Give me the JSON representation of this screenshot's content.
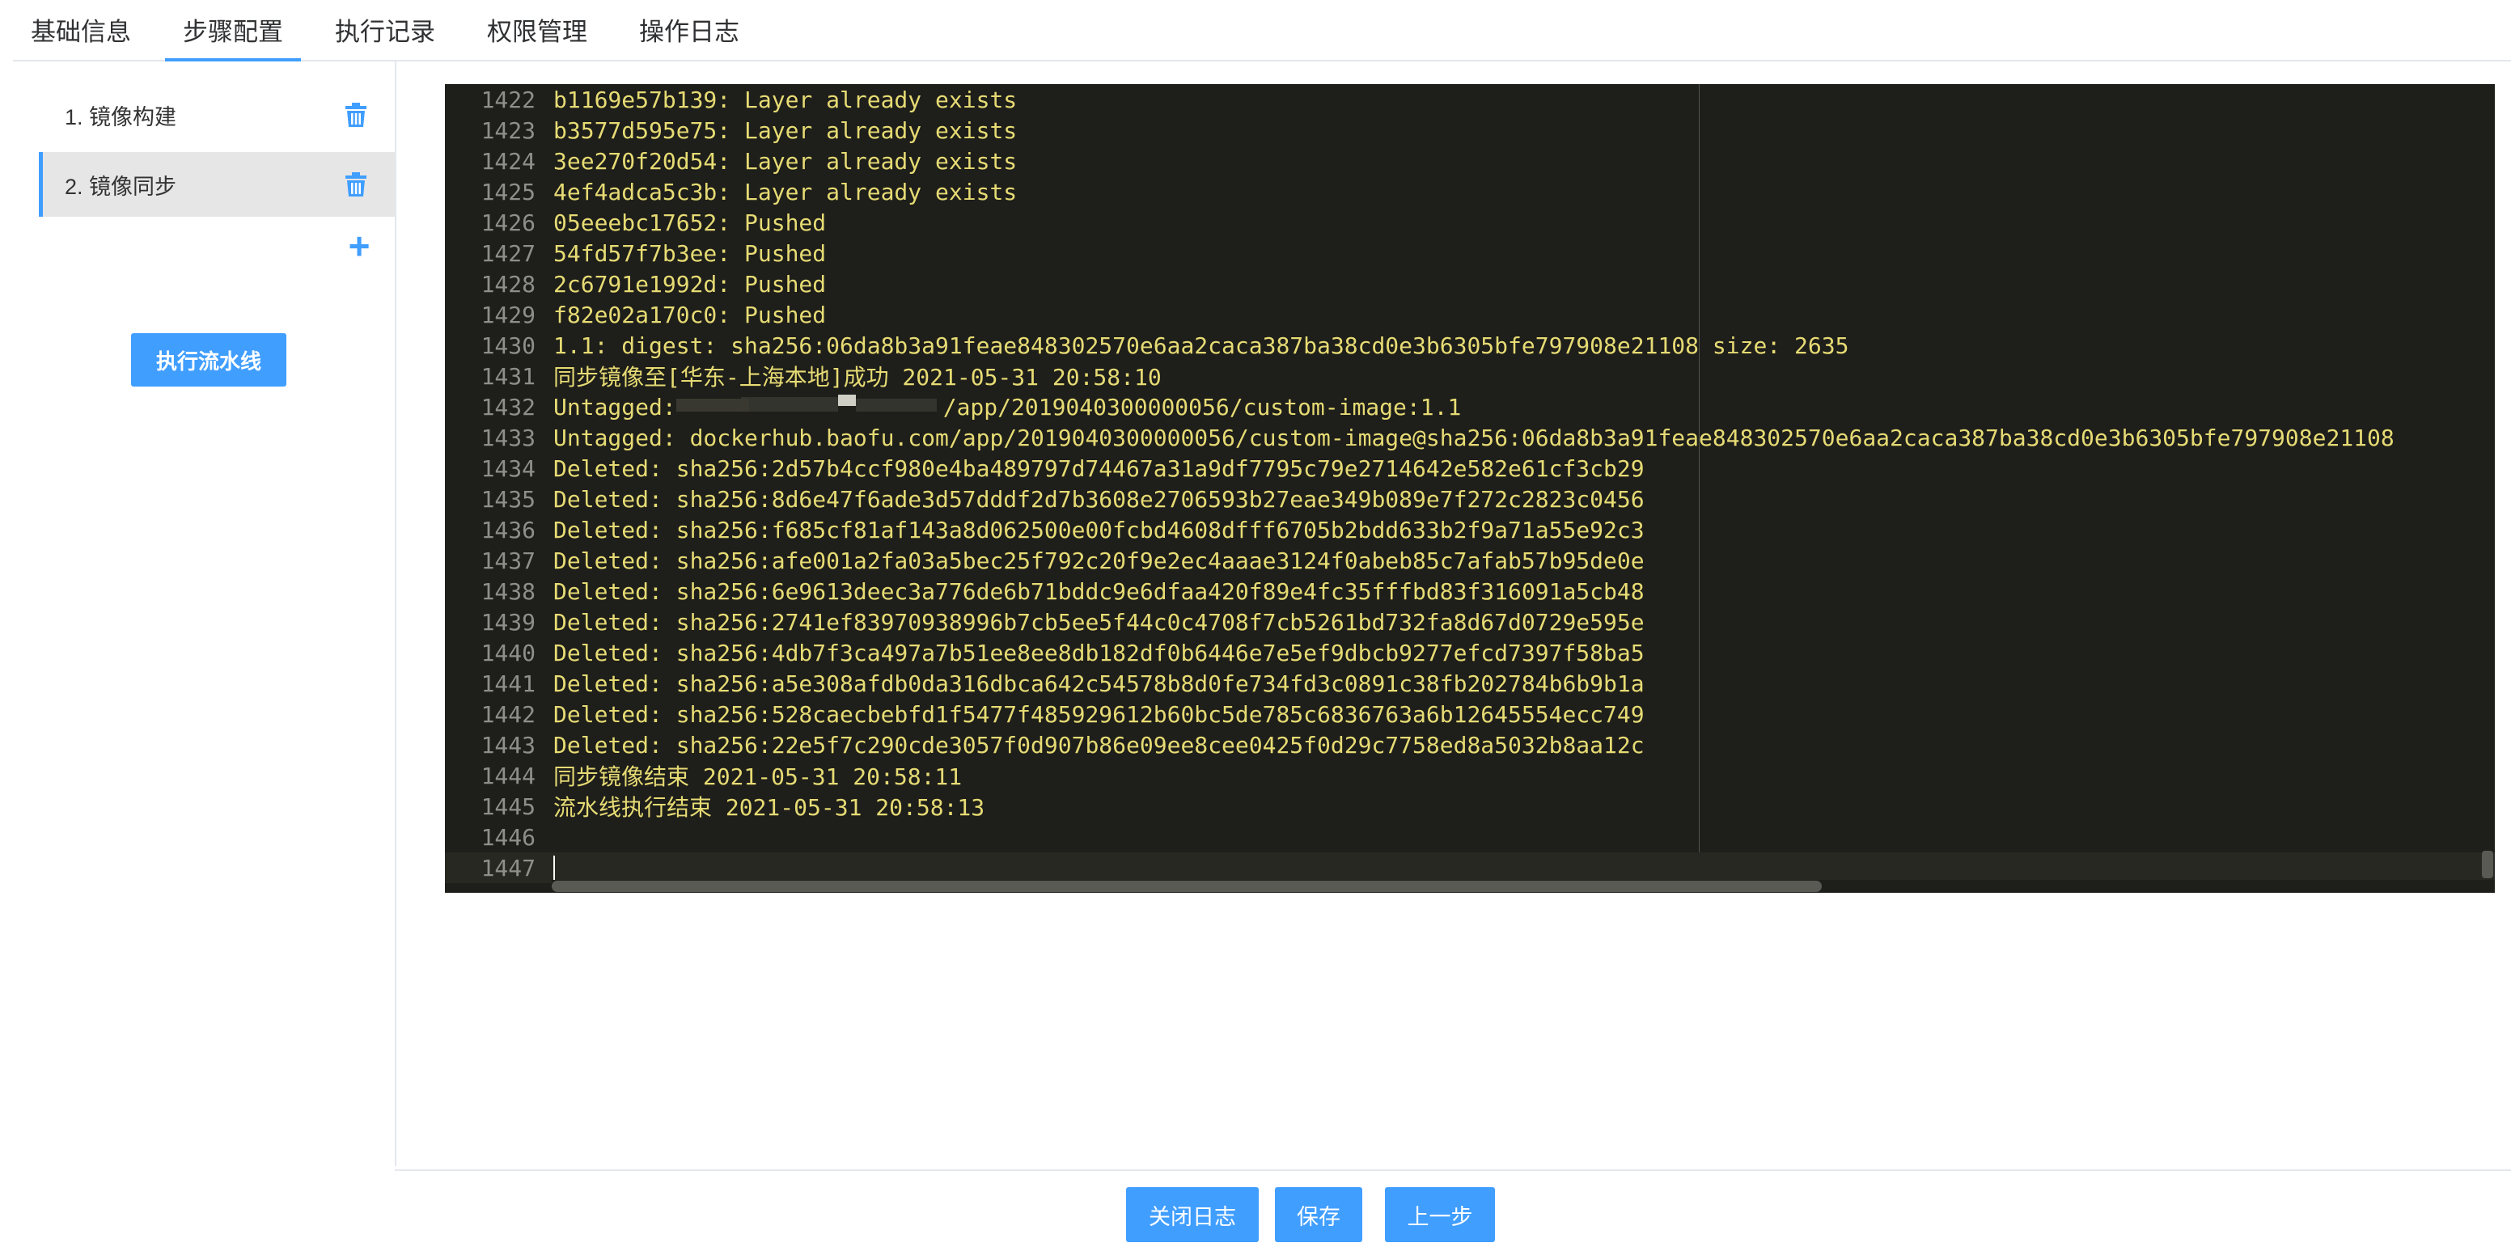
{
  "tabs": [
    "基础信息",
    "步骤配置",
    "执行记录",
    "权限管理",
    "操作日志"
  ],
  "active_tab": "步骤配置",
  "sidebar": {
    "steps": [
      {
        "label": "1. 镜像构建",
        "icon": "trash-icon"
      },
      {
        "label": "2. 镜像同步",
        "icon": "trash-icon"
      }
    ],
    "add_icon": "plus-icon",
    "run_button": "执行流水线"
  },
  "log": {
    "lines": [
      {
        "n": "1422",
        "t": "b1169e57b139: Layer already exists"
      },
      {
        "n": "1423",
        "t": "b3577d595e75: Layer already exists"
      },
      {
        "n": "1424",
        "t": "3ee270f20d54: Layer already exists"
      },
      {
        "n": "1425",
        "t": "4ef4adca5c3b: Layer already exists"
      },
      {
        "n": "1426",
        "t": "05eeebc17652: Pushed"
      },
      {
        "n": "1427",
        "t": "54fd57f7b3ee: Pushed"
      },
      {
        "n": "1428",
        "t": "2c6791e1992d: Pushed"
      },
      {
        "n": "1429",
        "t": "f82e02a170c0: Pushed"
      },
      {
        "n": "1430",
        "t": "1.1: digest: sha256:06da8b3a91feae848302570e6aa2caca387ba38cd0e3b6305bfe797908e21108 size: 2635"
      },
      {
        "n": "1431",
        "t": "同步镜像至[华东-上海本地]成功 2021-05-31 20:58:10"
      },
      {
        "n": "1432",
        "t": "Untagged: ",
        "t2": "/app/2019040300000056/custom-image:1.1"
      },
      {
        "n": "1433",
        "t": "Untagged: dockerhub.baofu.com/app/2019040300000056/custom-image@sha256:06da8b3a91feae848302570e6aa2caca387ba38cd0e3b6305bfe797908e21108"
      },
      {
        "n": "1434",
        "t": "Deleted: sha256:2d57b4ccf980e4ba489797d74467a31a9df7795c79e2714642e582e61cf3cb29"
      },
      {
        "n": "1435",
        "t": "Deleted: sha256:8d6e47f6ade3d57dddf2d7b3608e2706593b27eae349b089e7f272c2823c0456"
      },
      {
        "n": "1436",
        "t": "Deleted: sha256:f685cf81af143a8d062500e00fcbd4608dfff6705b2bdd633b2f9a71a55e92c3"
      },
      {
        "n": "1437",
        "t": "Deleted: sha256:afe001a2fa03a5bec25f792c20f9e2ec4aaae3124f0abeb85c7afab57b95de0e"
      },
      {
        "n": "1438",
        "t": "Deleted: sha256:6e9613deec3a776de6b71bddc9e6dfaa420f89e4fc35fffbd83f316091a5cb48"
      },
      {
        "n": "1439",
        "t": "Deleted: sha256:2741ef83970938996b7cb5ee5f44c0c4708f7cb5261bd732fa8d67d0729e595e"
      },
      {
        "n": "1440",
        "t": "Deleted: sha256:4db7f3ca497a7b51ee8ee8db182df0b6446e7e5ef9dbcb9277efcd7397f58ba5"
      },
      {
        "n": "1441",
        "t": "Deleted: sha256:a5e308afdb0da316dbca642c54578b8d0fe734fd3c0891c38fb202784b6b9b1a"
      },
      {
        "n": "1442",
        "t": "Deleted: sha256:528caecbebfd1f5477f485929612b60bc5de785c6836763a6b12645554ecc749"
      },
      {
        "n": "1443",
        "t": "Deleted: sha256:22e5f7c290cde3057f0d907b86e09ee8cee0425f0d29c7758ed8a5032b8aa12c"
      },
      {
        "n": "1444",
        "t": "同步镜像结束 2021-05-31 20:58:11"
      },
      {
        "n": "1445",
        "t": "流水线执行结束 2021-05-31 20:58:13"
      },
      {
        "n": "1446",
        "t": ""
      },
      {
        "n": "1447",
        "t": ""
      }
    ]
  },
  "footer": {
    "close_log": "关闭日志",
    "save": "保存",
    "prev": "上一步"
  },
  "colors": {
    "accent": "#409eff",
    "log_bg": "#1e1e1a",
    "log_text": "#e6db74",
    "line_number": "#8f8f8a"
  }
}
